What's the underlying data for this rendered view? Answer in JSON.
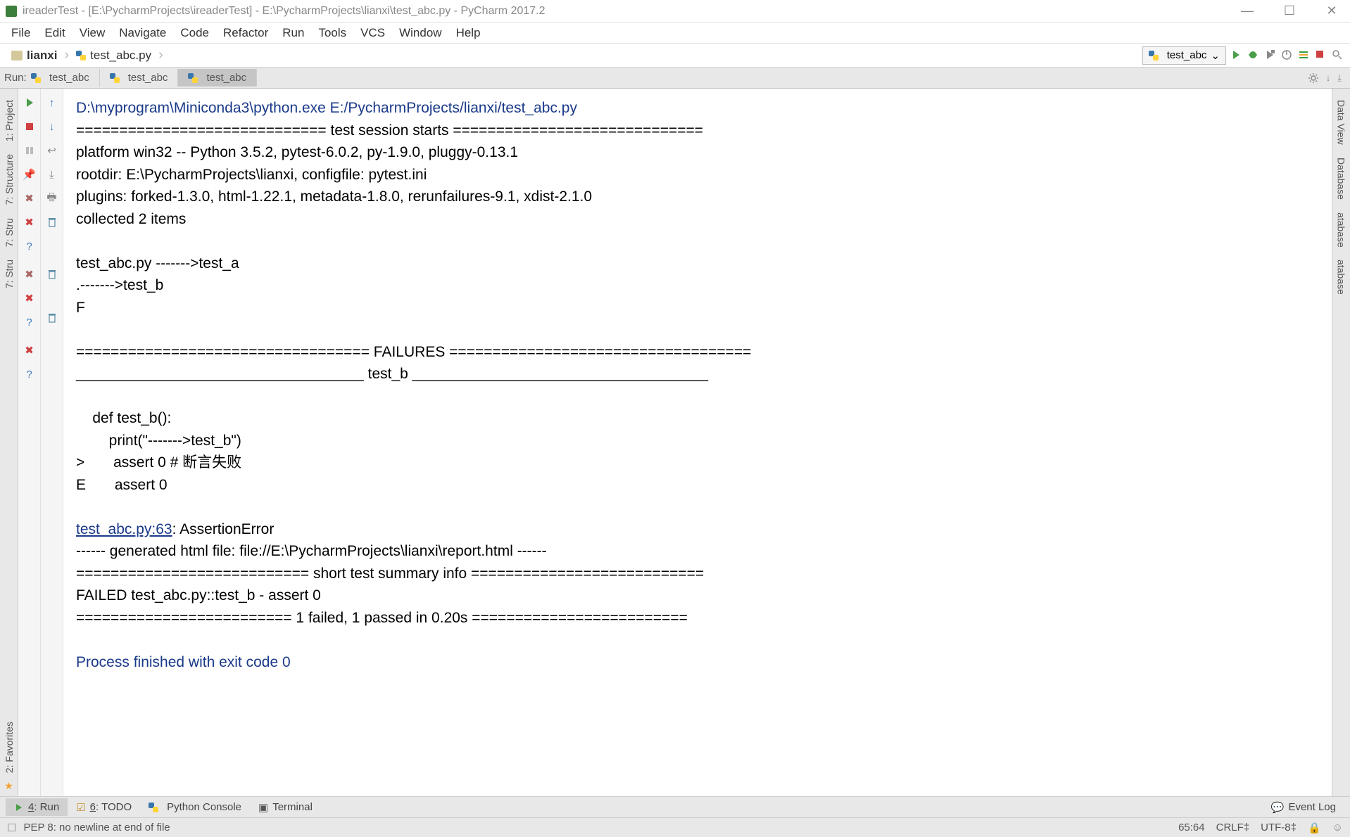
{
  "titlebar": {
    "text": "ireaderTest - [E:\\PycharmProjects\\ireaderTest] - E:\\PycharmProjects\\lianxi\\test_abc.py - PyCharm 2017.2"
  },
  "menu": [
    "File",
    "Edit",
    "View",
    "Navigate",
    "Code",
    "Refactor",
    "Run",
    "Tools",
    "VCS",
    "Window",
    "Help"
  ],
  "breadcrumb": {
    "folder": "lianxi",
    "file": "test_abc.py"
  },
  "run_config": {
    "selected": "test_abc"
  },
  "run_panel": {
    "label": "Run:",
    "tabs": [
      "test_abc",
      "test_abc",
      "test_abc"
    ],
    "active_index": 2
  },
  "side_rails": {
    "left": [
      "1: Project",
      "7: Structure",
      "7: Stru",
      "7: Stru",
      "2: Favorites"
    ],
    "right": [
      "Data View",
      "Database",
      "atabase",
      "atabase"
    ]
  },
  "console": {
    "lines": [
      {
        "cls": "c-blue",
        "text": "D:\\myprogram\\Miniconda3\\python.exe E:/PycharmProjects/lianxi/test_abc.py"
      },
      {
        "cls": "c-black",
        "text": "============================= test session starts ============================="
      },
      {
        "cls": "c-black",
        "text": "platform win32 -- Python 3.5.2, pytest-6.0.2, py-1.9.0, pluggy-0.13.1"
      },
      {
        "cls": "c-black",
        "text": "rootdir: E:\\PycharmProjects\\lianxi, configfile: pytest.ini"
      },
      {
        "cls": "c-black",
        "text": "plugins: forked-1.3.0, html-1.22.1, metadata-1.8.0, rerunfailures-9.1, xdist-2.1.0"
      },
      {
        "cls": "c-black",
        "text": "collected 2 items"
      },
      {
        "cls": "c-black",
        "text": ""
      },
      {
        "cls": "c-black",
        "text": "test_abc.py ------->test_a"
      },
      {
        "cls": "c-black",
        "text": ".------->test_b"
      },
      {
        "cls": "c-black",
        "text": "F"
      },
      {
        "cls": "c-black",
        "text": ""
      },
      {
        "cls": "c-black",
        "text": "================================== FAILURES ==================================="
      },
      {
        "cls": "c-black",
        "text": "___________________________________ test_b ____________________________________"
      },
      {
        "cls": "c-black",
        "text": ""
      },
      {
        "cls": "c-black",
        "text": "    def test_b():"
      },
      {
        "cls": "c-black",
        "text": "        print(\"------->test_b\")"
      },
      {
        "cls": "c-black",
        "text": ">       assert 0 # 断言失败"
      },
      {
        "cls": "c-black",
        "text": "E       assert 0"
      },
      {
        "cls": "c-black",
        "text": ""
      },
      {
        "cls": "c-link",
        "text": "test_abc.py:63",
        "tail": ": AssertionError"
      },
      {
        "cls": "c-black",
        "text": "------ generated html file: file://E:\\PycharmProjects\\lianxi\\report.html ------"
      },
      {
        "cls": "c-black",
        "text": "=========================== short test summary info ==========================="
      },
      {
        "cls": "c-black",
        "text": "FAILED test_abc.py::test_b - assert 0"
      },
      {
        "cls": "c-black",
        "text": "========================= 1 failed, 1 passed in 0.20s ========================="
      },
      {
        "cls": "c-black",
        "text": ""
      },
      {
        "cls": "c-blue",
        "text": "Process finished with exit code 0"
      }
    ]
  },
  "bottom_tools": {
    "run": "4: Run",
    "todo": "6: TODO",
    "console": "Python Console",
    "terminal": "Terminal",
    "event_log": "Event Log"
  },
  "statusbar": {
    "msg": "PEP 8: no newline at end of file",
    "pos": "65:64",
    "eol": "CRLF",
    "enc": "UTF-8"
  }
}
